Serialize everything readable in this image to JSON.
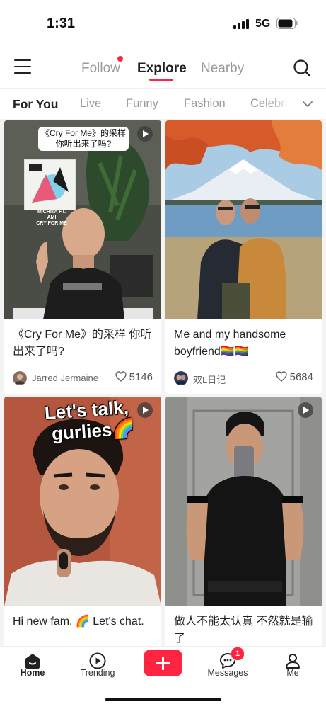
{
  "status_bar": {
    "time": "1:31",
    "network": "5G",
    "icons": [
      "signal-icon",
      "battery-icon"
    ]
  },
  "top_nav": {
    "tabs": [
      {
        "label": "Follow",
        "has_dot": true
      },
      {
        "label": "Explore",
        "active": true
      },
      {
        "label": "Nearby"
      }
    ],
    "icons": [
      "menu-icon",
      "search-icon"
    ]
  },
  "categories": {
    "items": [
      "For You",
      "Live",
      "Funny",
      "Fashion",
      "Celebri"
    ],
    "active": "For You",
    "expand_icon": "chevron-down-icon"
  },
  "feed": {
    "posts": [
      {
        "title": "《Cry For Me》的采样 你听出来了吗?",
        "overlay_text_line1": "《Cry For Me》的采样",
        "overlay_text_line2": "你听出来了吗?",
        "album_caption_line1": "MICHITA FT. AMI",
        "album_caption_line2": "CRY FOR ME",
        "author": "Jarred Jermaine",
        "likes": "5146",
        "is_video": true
      },
      {
        "title": "Me and my handsome boyfriend🏳️‍🌈🏳️‍🌈",
        "author": "双L日记",
        "likes": "5684",
        "is_video": false
      },
      {
        "title": "Hi new fam. 🌈 Let's chat.",
        "overlay_text_line1": "Let's talk,",
        "overlay_text_line2": "gurlies🌈",
        "is_video": true
      },
      {
        "title": "做人不能太认真 不然就是输了",
        "is_video": true
      }
    ]
  },
  "bottom_nav": {
    "home": "Home",
    "trending": "Trending",
    "messages": "Messages",
    "messages_badge": "1",
    "me": "Me"
  },
  "colors": {
    "accent": "#ff2442",
    "text": "#222222",
    "muted": "#999999",
    "feed_bg": "#f4f4f4"
  }
}
